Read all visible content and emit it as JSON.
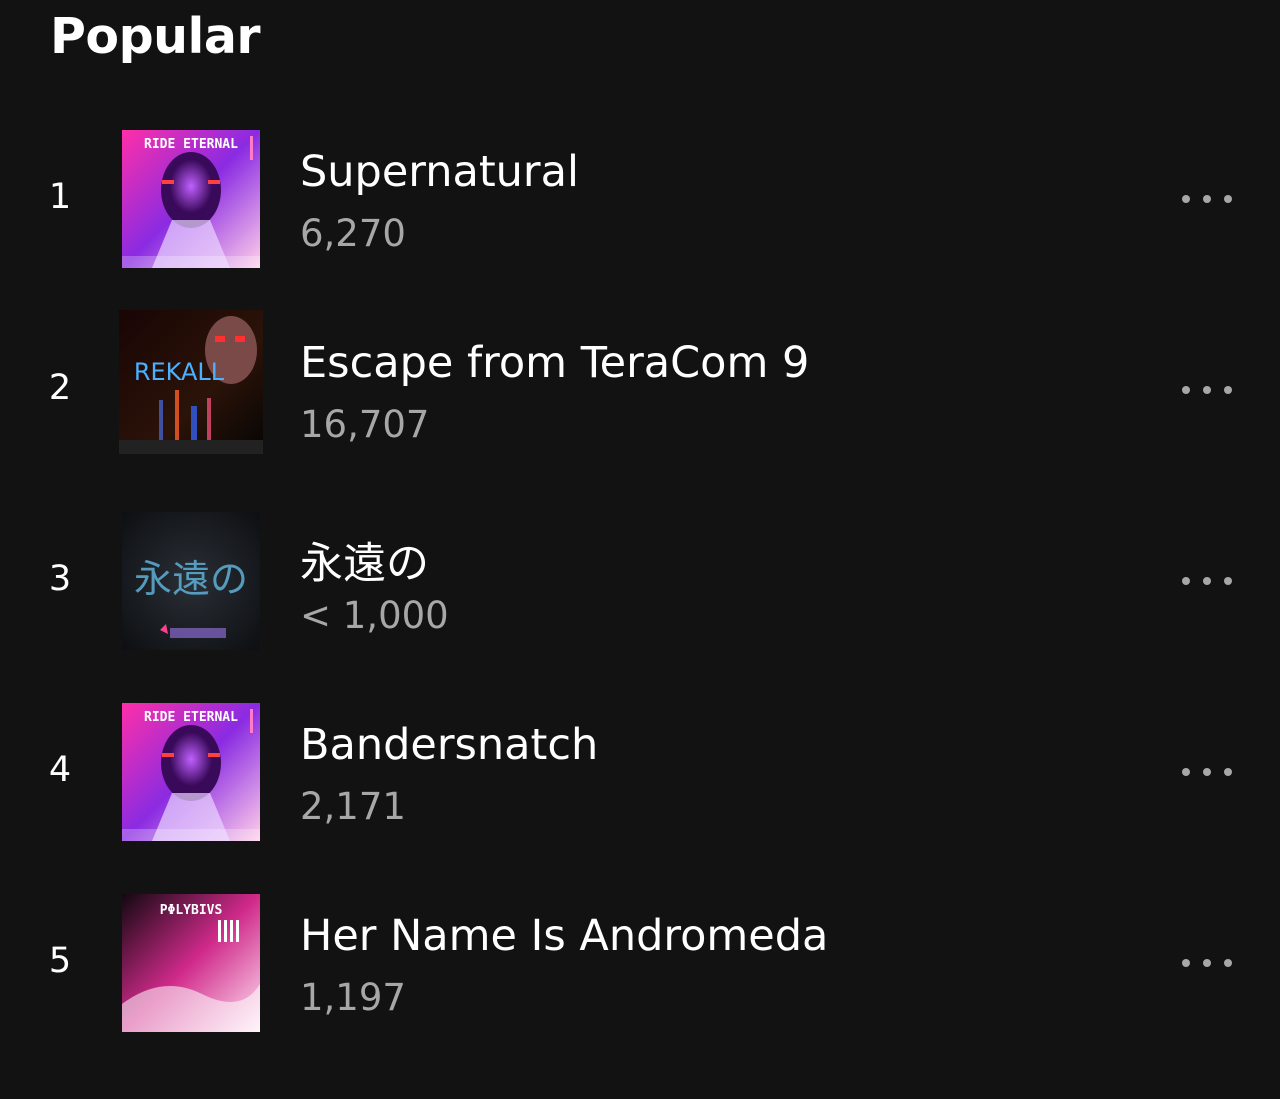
{
  "section": {
    "title": "Popular"
  },
  "tracks": [
    {
      "index": "1",
      "title": "Supernatural",
      "plays": "6,270",
      "cover_text": "RIDE ETERNAL"
    },
    {
      "index": "2",
      "title": "Escape from TeraCom 9",
      "plays": "16,707",
      "cover_text": "REKALL"
    },
    {
      "index": "3",
      "title": "永遠の",
      "plays": "< 1,000",
      "cover_text": "永遠の"
    },
    {
      "index": "4",
      "title": "Bandersnatch",
      "plays": "2,171",
      "cover_text": "RIDE ETERNAL"
    },
    {
      "index": "5",
      "title": "Her Name Is Andromeda",
      "plays": "1,197",
      "cover_text": "PΦLYBIVS"
    }
  ],
  "icons": {
    "more": "more-options-icon"
  },
  "colors": {
    "background": "#121212",
    "primary_text": "#ffffff",
    "secondary_text": "#a7a7a7"
  }
}
